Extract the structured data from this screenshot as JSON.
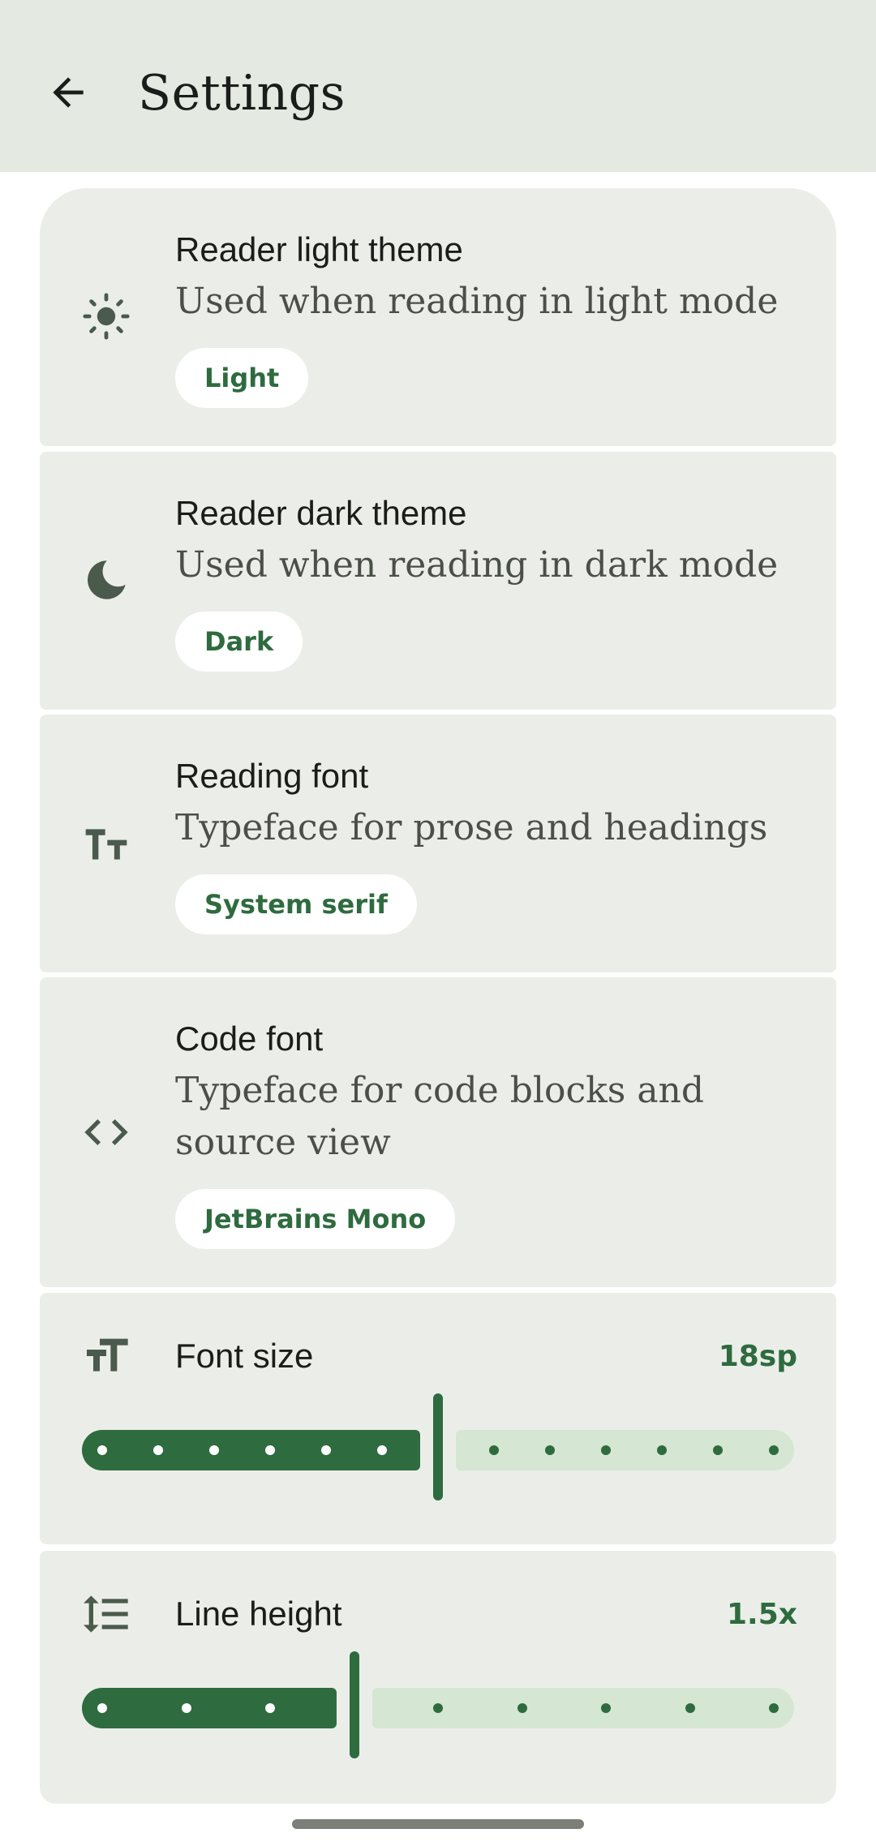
{
  "appbar": {
    "title": "Settings",
    "back_icon": "arrow-back-icon"
  },
  "cards": {
    "light_theme": {
      "icon": "sun-icon",
      "title": "Reader light theme",
      "subtitle": "Used when reading in light mode",
      "value": "Light"
    },
    "dark_theme": {
      "icon": "moon-icon",
      "title": "Reader dark theme",
      "subtitle": "Used when reading in dark mode",
      "value": "Dark"
    },
    "reading_font": {
      "icon": "text-fields-icon",
      "title": "Reading font",
      "subtitle": "Typeface for prose and headings",
      "value": "System serif"
    },
    "code_font": {
      "icon": "code-icon",
      "title": "Code font",
      "subtitle": "Typeface for code blocks and source view",
      "value": "JetBrains Mono"
    },
    "font_size": {
      "icon": "format-size-icon",
      "title": "Font size",
      "value": "18sp",
      "slider_steps": 13,
      "slider_index": 6
    },
    "line_height": {
      "icon": "line-spacing-icon",
      "title": "Line height",
      "value": "1.5x",
      "slider_steps": 9,
      "slider_index": 3
    }
  },
  "colors": {
    "accent": "#2e6b3f",
    "track_inactive": "#d5e6d3",
    "card_bg": "#ebeee8",
    "appbar_bg": "#e4e9e2"
  }
}
